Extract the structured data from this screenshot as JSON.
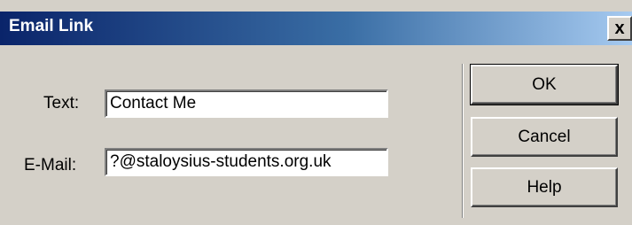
{
  "window": {
    "title": "Email Link",
    "close_glyph": "x",
    "close_icon": "close-icon"
  },
  "form": {
    "text_label": "Text:",
    "text_value": "Contact Me",
    "email_label": "E-Mail:",
    "email_value": "?@staloysius-students.org.uk"
  },
  "buttons": {
    "ok": "OK",
    "cancel": "Cancel",
    "help": "Help"
  },
  "colors": {
    "titlebar_start": "#0a246a",
    "titlebar_end": "#a6caf0",
    "face": "#d4d0c8"
  }
}
